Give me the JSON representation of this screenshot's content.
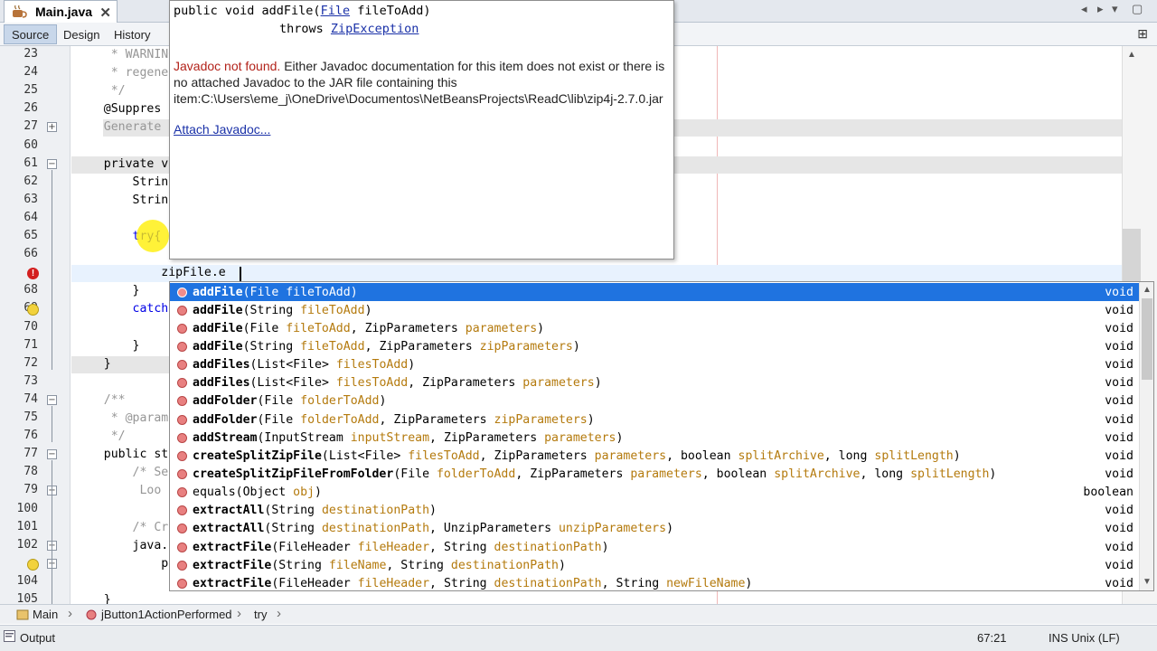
{
  "tabs": {
    "file_name": "Main.java",
    "close_glyph": "✕",
    "nav_controls": [
      "◂",
      "▸",
      "▾",
      "▢"
    ]
  },
  "view_buttons": {
    "source": "Source",
    "design": "Design",
    "history": "History"
  },
  "gutter": {
    "line_numbers": [
      "23",
      "24",
      "25",
      "26",
      "27",
      "60",
      "61",
      "62",
      "63",
      "64",
      "65",
      "66",
      "",
      "68",
      "69",
      "70",
      "71",
      "72",
      "73",
      "74",
      "75",
      "76",
      "77",
      "78",
      "79",
      "100",
      "101",
      "102",
      "",
      "104",
      "105"
    ]
  },
  "code": {
    "lines": [
      {
        "text": "     * WARNING",
        "cls": "cm",
        "x": 33
      },
      {
        "text": "     * regene",
        "cls": "cm",
        "x": 33
      },
      {
        "text": "     */",
        "cls": "cm",
        "x": 33
      },
      {
        "text": "    @Suppres",
        "cls": "an",
        "x": 4
      },
      {
        "text": "    Generate",
        "cls": "cm",
        "x": 4
      },
      {
        "text": "",
        "cls": "",
        "x": 4
      },
      {
        "text": "    private v",
        "cls": "",
        "x": 4
      },
      {
        "text": "        Strin",
        "cls": "",
        "x": 4
      },
      {
        "text": "        Strin",
        "cls": "",
        "x": 4
      },
      {
        "text": "",
        "cls": "",
        "x": 4
      },
      {
        "text": "        try{",
        "cls": "kw",
        "x": 4
      },
      {
        "text": "",
        "cls": "",
        "x": 4
      },
      {
        "text": "            zipFile.e",
        "cls": "",
        "x": 4
      },
      {
        "text": "        }",
        "cls": "",
        "x": 4
      },
      {
        "text": "        catch",
        "cls": "kw",
        "x": 4
      },
      {
        "text": "",
        "cls": "",
        "x": 4
      },
      {
        "text": "        }",
        "cls": "",
        "x": 4
      },
      {
        "text": "    }",
        "cls": "",
        "x": 4
      },
      {
        "text": "",
        "cls": "",
        "x": 4
      },
      {
        "text": "    /**",
        "cls": "cm",
        "x": 4
      },
      {
        "text": "     * @param",
        "cls": "cm",
        "x": 4
      },
      {
        "text": "     */",
        "cls": "cm",
        "x": 4
      },
      {
        "text": "    public st",
        "cls": "",
        "x": 4
      },
      {
        "text": "        /* Se",
        "cls": "cm",
        "x": 4
      },
      {
        "text": "         Loo",
        "cls": "cm",
        "x": 4
      },
      {
        "text": "",
        "cls": "",
        "x": 4
      },
      {
        "text": "        /* Cr",
        "cls": "cm",
        "x": 4
      },
      {
        "text": "        java.",
        "cls": "",
        "x": 4
      },
      {
        "text": "            p",
        "cls": "",
        "x": 4
      },
      {
        "text": "",
        "cls": "",
        "x": 4
      },
      {
        "text": "    }",
        "cls": "",
        "x": 4
      }
    ]
  },
  "javadoc": {
    "sig_prefix": "public void addFile(",
    "sig_type": "File",
    "sig_param": " fileToAdd)",
    "throws_label": "throws ",
    "throws_type": "ZipException",
    "not_found": "Javadoc not found.",
    "message": " Either Javadoc documentation for this item does not exist or there is no attached Javadoc to the JAR file containing this item:C:\\Users\\eme_j\\OneDrive\\Documentos\\NetBeansProjects\\ReadC\\lib\\zip4j-2.7.0.jar",
    "attach_link": "Attach Javadoc..."
  },
  "completion": {
    "items": [
      {
        "name": "addFile",
        "args": [
          [
            "File ",
            "fileToAdd"
          ]
        ],
        "ret": "void",
        "selected": true
      },
      {
        "name": "addFile",
        "args": [
          [
            "String ",
            "fileToAdd"
          ]
        ],
        "ret": "void"
      },
      {
        "name": "addFile",
        "args": [
          [
            "File ",
            "fileToAdd"
          ],
          [
            "ZipParameters ",
            "parameters"
          ]
        ],
        "ret": "void"
      },
      {
        "name": "addFile",
        "args": [
          [
            "String ",
            "fileToAdd"
          ],
          [
            "ZipParameters ",
            "zipParameters"
          ]
        ],
        "ret": "void"
      },
      {
        "name": "addFiles",
        "args": [
          [
            "List<File> ",
            "filesToAdd"
          ]
        ],
        "ret": "void"
      },
      {
        "name": "addFiles",
        "args": [
          [
            "List<File> ",
            "filesToAdd"
          ],
          [
            "ZipParameters ",
            "parameters"
          ]
        ],
        "ret": "void"
      },
      {
        "name": "addFolder",
        "args": [
          [
            "File ",
            "folderToAdd"
          ]
        ],
        "ret": "void"
      },
      {
        "name": "addFolder",
        "args": [
          [
            "File ",
            "folderToAdd"
          ],
          [
            "ZipParameters ",
            "zipParameters"
          ]
        ],
        "ret": "void"
      },
      {
        "name": "addStream",
        "args": [
          [
            "InputStream ",
            "inputStream"
          ],
          [
            "ZipParameters ",
            "parameters"
          ]
        ],
        "ret": "void"
      },
      {
        "name": "createSplitZipFile",
        "args": [
          [
            "List<File> ",
            "filesToAdd"
          ],
          [
            "ZipParameters ",
            "parameters"
          ],
          [
            "boolean ",
            "splitArchive"
          ],
          [
            "long ",
            "splitLength"
          ]
        ],
        "ret": "void"
      },
      {
        "name": "createSplitZipFileFromFolder",
        "args": [
          [
            "File ",
            "folderToAdd"
          ],
          [
            "ZipParameters ",
            "parameters"
          ],
          [
            "boolean ",
            "splitArchive"
          ],
          [
            "long ",
            "splitLength"
          ]
        ],
        "ret": "void"
      },
      {
        "name": "equals",
        "args": [
          [
            "Object ",
            "obj"
          ]
        ],
        "ret": "boolean",
        "plain": true
      },
      {
        "name": "extractAll",
        "args": [
          [
            "String ",
            "destinationPath"
          ]
        ],
        "ret": "void"
      },
      {
        "name": "extractAll",
        "args": [
          [
            "String ",
            "destinationPath"
          ],
          [
            "UnzipParameters ",
            "unzipParameters"
          ]
        ],
        "ret": "void"
      },
      {
        "name": "extractFile",
        "args": [
          [
            "FileHeader ",
            "fileHeader"
          ],
          [
            "String ",
            "destinationPath"
          ]
        ],
        "ret": "void"
      },
      {
        "name": "extractFile",
        "args": [
          [
            "String ",
            "fileName"
          ],
          [
            "String ",
            "destinationPath"
          ]
        ],
        "ret": "void"
      },
      {
        "name": "extractFile",
        "args": [
          [
            "FileHeader ",
            "fileHeader"
          ],
          [
            "String ",
            "destinationPath"
          ],
          [
            "String ",
            "newFileName"
          ]
        ],
        "ret": "void"
      }
    ]
  },
  "breadcrumb": {
    "project": "Main",
    "method": "jButton1ActionPerformed",
    "block": "try"
  },
  "status": {
    "output": "Output",
    "position": "67:21",
    "mode": "INS",
    "line_ending": "Unix (LF)"
  }
}
